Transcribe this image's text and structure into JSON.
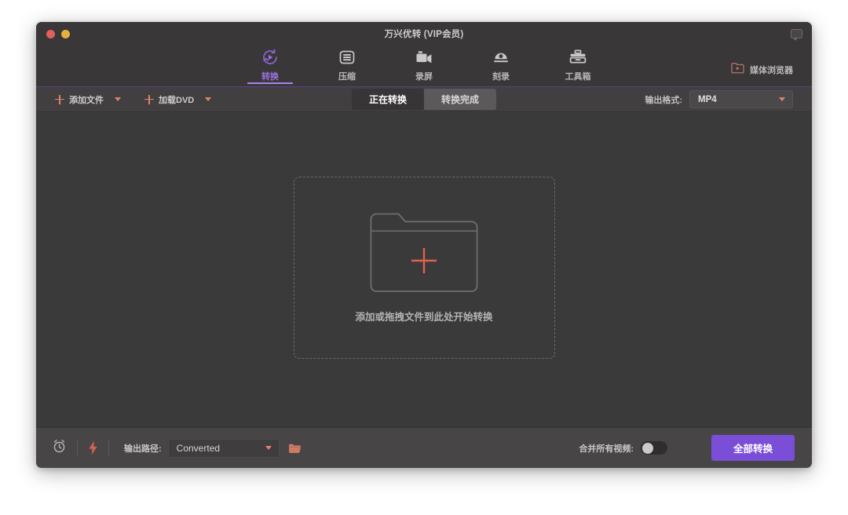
{
  "window": {
    "title": "万兴优转 (VIP会员)",
    "traffic_lights": [
      "close",
      "minimize"
    ],
    "feedback_icon": "feedback-bubble-icon",
    "accent_purple": "#7b4ed8",
    "accent_coral": "#e0836d",
    "bg_titlebar": "#3a3739",
    "bg_content": "#3b3a3a",
    "bg_bottombar": "#484547"
  },
  "nav": {
    "tabs": [
      {
        "label": "转换",
        "icon": "convert-circular-arrow-icon",
        "active": true
      },
      {
        "label": "压缩",
        "icon": "compress-lines-icon",
        "active": false
      },
      {
        "label": "录屏",
        "icon": "screen-record-camera-icon",
        "active": false
      },
      {
        "label": "刻录",
        "icon": "burn-disc-icon",
        "active": false
      },
      {
        "label": "工具箱",
        "icon": "toolbox-icon",
        "active": false
      }
    ],
    "media_browser": {
      "label": "媒体浏览器",
      "icon": "folder-play-icon"
    }
  },
  "toolbar": {
    "add_file": {
      "label": "添加文件",
      "icon": "plus-icon",
      "caret": "chevron-down-icon"
    },
    "load_dvd": {
      "label": "加载DVD",
      "icon": "plus-icon",
      "caret": "chevron-down-icon"
    },
    "segments": [
      {
        "label": "正在转换",
        "active": true
      },
      {
        "label": "转换完成",
        "active": false
      }
    ],
    "output_format": {
      "label": "输出格式:",
      "value": "MP4",
      "caret": "chevron-down-icon"
    }
  },
  "main": {
    "dropzone": {
      "text": "添加或拖拽文件到此处开始转换",
      "folder_icon": "folder-outline-icon",
      "plus_icon": "plus-icon"
    }
  },
  "bottom": {
    "timer_icon": "alarm-clock-icon",
    "speed_icon": "lightning-bolt-icon",
    "output_path": {
      "label": "输出路径:",
      "value": "Converted",
      "caret": "chevron-down-icon",
      "browse_icon": "folder-open-icon"
    },
    "merge": {
      "label": "合并所有视频:",
      "enabled": false
    },
    "convert_all_label": "全部转换"
  }
}
